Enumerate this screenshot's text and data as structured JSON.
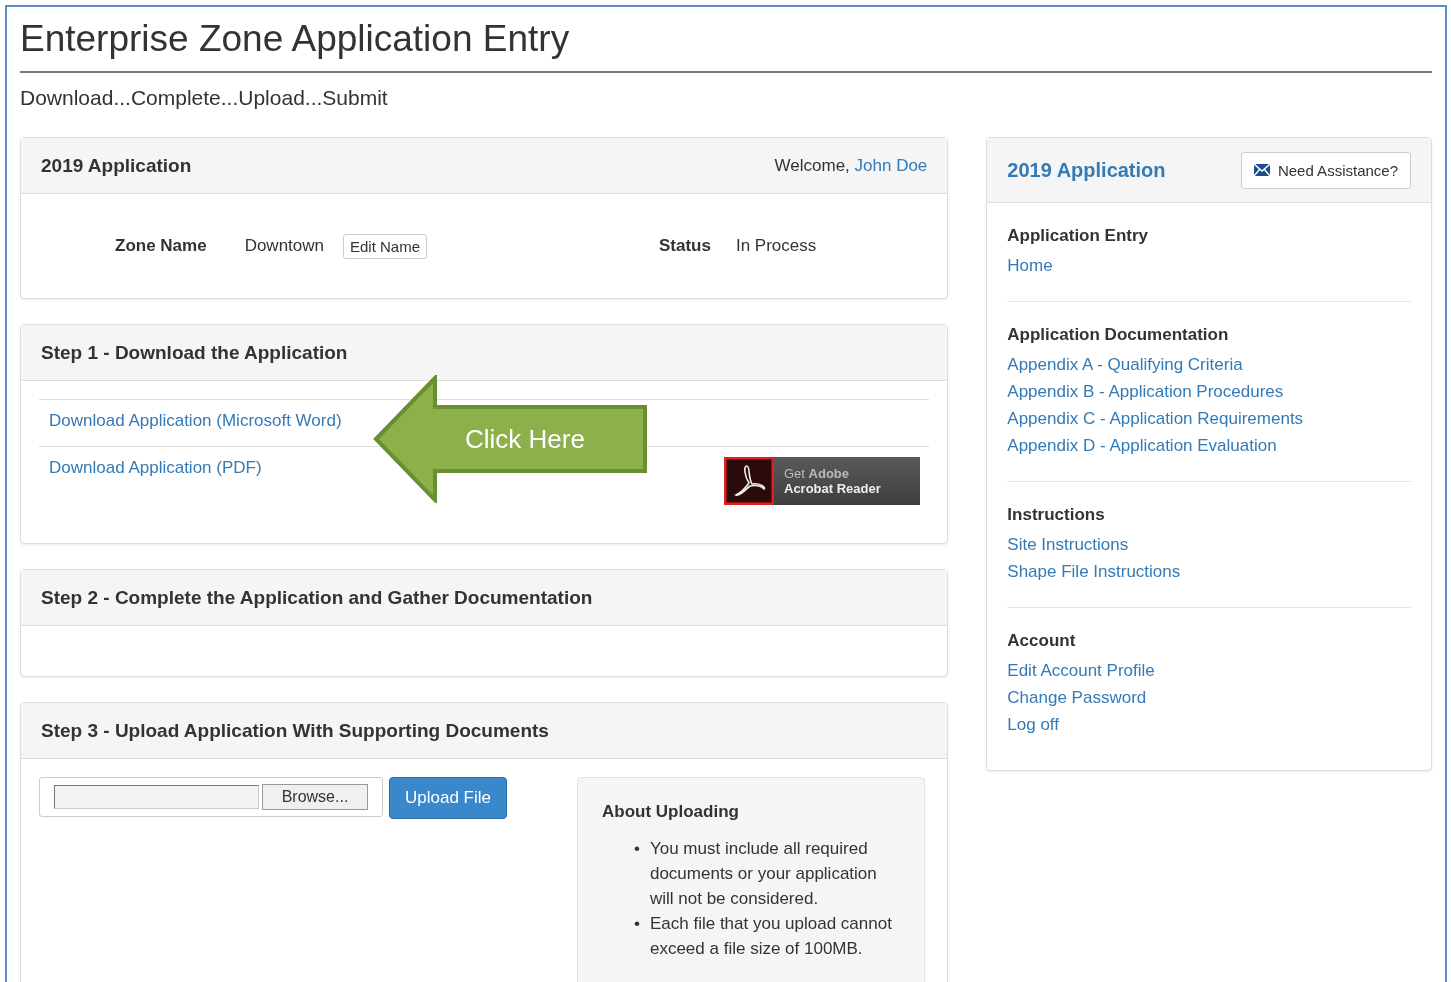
{
  "page": {
    "title": "Enterprise Zone Application Entry",
    "subtitle": "Download...Complete...Upload...Submit"
  },
  "application_panel": {
    "title": "2019 Application",
    "welcome_label": "Welcome,",
    "user_name": "John Doe",
    "fields": [
      {
        "label": "Zone Name",
        "value": "Downtown",
        "button": "Edit Name"
      },
      {
        "label": "Status",
        "value": "In Process"
      }
    ]
  },
  "steps": [
    {
      "kind": "download",
      "title": "Step 1 - Download the Application",
      "links": [
        "Download Application (Microsoft Word)",
        "Download Application (PDF)"
      ],
      "callout": "Click Here",
      "badge": "Get **Adobe**",
      "badge_line_2": "Acrobat Reader"
    },
    {
      "kind": "empty",
      "title": "Step 2 - Complete the Application and Gather Documentation"
    },
    {
      "kind": "upload",
      "title": "Step 3 - Upload Application With Supporting Documents",
      "browse_button": "Browse...",
      "upload_button": "Upload File",
      "about_title": "About Uploading",
      "about_items": [
        {
          "bullet": "•",
          "text": "You must include all required documents or your application will not be considered."
        },
        {
          "bullet": "•",
          "text": "Each file that you upload cannot exceed a file size of 100MB."
        }
      ]
    }
  ],
  "sidebar": {
    "title": "2019 Application",
    "assist_button": "Need Assistance?",
    "sections": [
      {
        "heading": "Application Entry",
        "links": [
          "Home"
        ]
      },
      {
        "heading": "Application Documentation",
        "links": [
          "Appendix A - Qualifying Criteria",
          "Appendix B - Application Procedures",
          "Appendix C - Application Requirements",
          "Appendix D - Application Evaluation"
        ]
      },
      {
        "heading": "Instructions",
        "links": [
          "Site Instructions",
          "Shape File Instructions"
        ]
      },
      {
        "heading": "Account",
        "links": [
          "Edit Account Profile",
          "Change Password",
          "Log off"
        ]
      }
    ]
  }
}
